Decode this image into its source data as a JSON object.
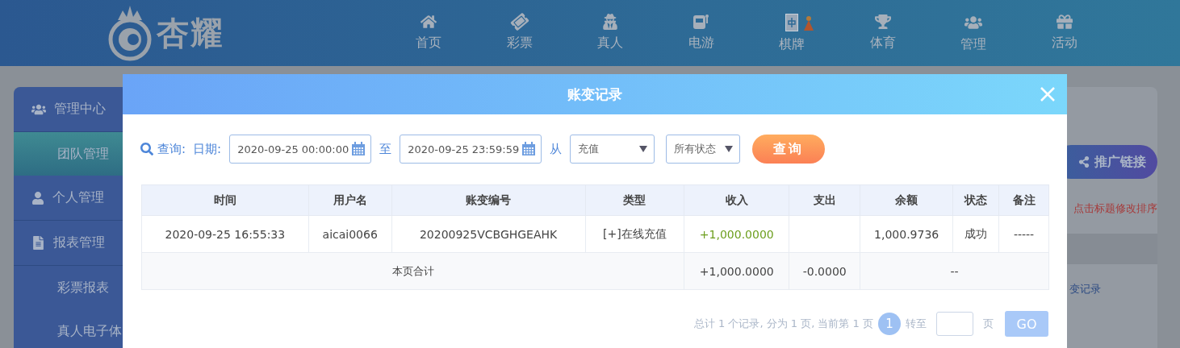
{
  "header": {
    "logo_text": "杏耀",
    "nav": [
      {
        "label": "首页"
      },
      {
        "label": "彩票"
      },
      {
        "label": "真人"
      },
      {
        "label": "电游"
      },
      {
        "label": "棋牌"
      },
      {
        "label": "体育"
      },
      {
        "label": "管理"
      },
      {
        "label": "活动"
      }
    ]
  },
  "sidebar": {
    "items": [
      {
        "label": "管理中心",
        "kind": "group",
        "selected": false
      },
      {
        "label": "团队管理",
        "kind": "sub",
        "selected": true
      },
      {
        "label": "个人管理",
        "kind": "group",
        "selected": false
      },
      {
        "label": "报表管理",
        "kind": "group",
        "selected": false
      },
      {
        "label": "彩票报表",
        "kind": "sub",
        "selected": false
      },
      {
        "label": "真人电子体",
        "kind": "sub",
        "selected": false
      }
    ]
  },
  "side_panel": {
    "button": "推广链接",
    "hint": "点击标题修改排序",
    "link": "变记录"
  },
  "dialog": {
    "title": "账变记录",
    "query": {
      "search_label": "查询:",
      "date_label": "日期:",
      "date_from": "2020-09-25 00:00:00",
      "to_label": "至",
      "date_to": "2020-09-25 23:59:59",
      "from_label": "从",
      "type_select": "充值",
      "status_select": "所有状态",
      "button": "查询"
    },
    "table": {
      "columns": [
        "时间",
        "用户名",
        "账变编号",
        "类型",
        "收入",
        "支出",
        "余额",
        "状态",
        "备注"
      ],
      "rows": [
        {
          "cells": [
            {
              "text": "2020-09-25 16:55:33",
              "kind": "plain"
            },
            {
              "text": "aicai0066",
              "kind": "plain"
            },
            {
              "text": "20200925VCBGHGEAHK",
              "kind": "plain"
            },
            {
              "text": "[+]在线充值",
              "kind": "plain"
            },
            {
              "text": "+1,000.0000",
              "kind": "credit"
            },
            {
              "kind": "empty"
            },
            {
              "text": "1,000.9736",
              "kind": "plain"
            },
            {
              "text": "成功",
              "kind": "plain"
            },
            {
              "text": "-----",
              "kind": "plain"
            }
          ]
        }
      ],
      "summary": {
        "label": "本页合计",
        "income": "+1,000.0000",
        "expense": "-0.0000",
        "balance": "--"
      }
    },
    "pagination": {
      "summary": "总计 1 个记录, 分为 1 页, 当前第 1 页",
      "current": "1",
      "goto_label": "转至",
      "page_label": "页",
      "go_button": "GO"
    }
  }
}
